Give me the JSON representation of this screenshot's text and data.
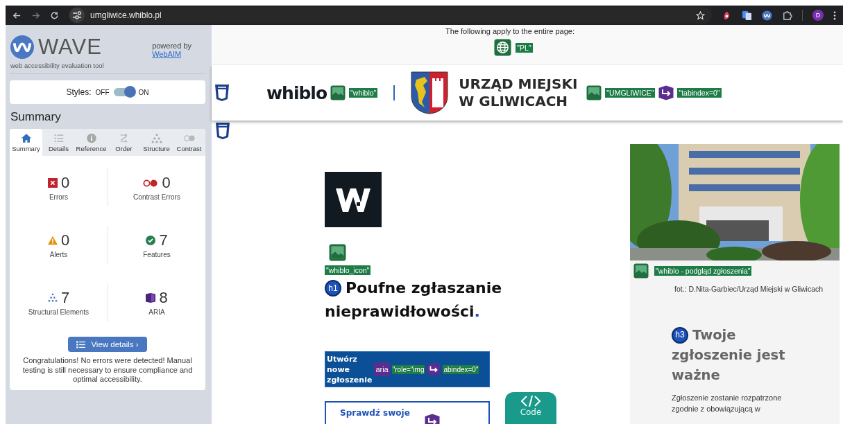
{
  "browser": {
    "url": "umgliwice.whiblo.pl",
    "profile_initial": "D"
  },
  "wave": {
    "title": "WAVE",
    "tagline": "web accessibility evaluation tool",
    "powered_by": "powered by",
    "powered_link": "WebAIM",
    "styles": {
      "label": "Styles:",
      "off_label": "OFF",
      "on_label": "ON",
      "on": true
    },
    "heading": "Summary",
    "tabs": [
      {
        "label": "Summary",
        "kind": "home",
        "selected": true
      },
      {
        "label": "Details",
        "kind": "list",
        "selected": false
      },
      {
        "label": "Reference",
        "kind": "info",
        "selected": false
      },
      {
        "label": "Order",
        "kind": "order",
        "selected": false
      },
      {
        "label": "Structure",
        "kind": "tree",
        "selected": false
      },
      {
        "label": "Contrast",
        "kind": "contrast",
        "selected": false
      }
    ],
    "stats": [
      {
        "kind": "error",
        "count": "0",
        "label": "Errors"
      },
      {
        "kind": "contrast",
        "count": "0",
        "label": "Contrast Errors"
      },
      {
        "kind": "alert",
        "count": "0",
        "label": "Alerts"
      },
      {
        "kind": "feature",
        "count": "7",
        "label": "Features"
      },
      {
        "kind": "structure",
        "count": "7",
        "label": "Structural Elements"
      },
      {
        "kind": "aria",
        "count": "8",
        "label": "ARIA"
      }
    ],
    "view_details": "View details ›",
    "message": "Congratulations! No errors were detected! Manual testing is still necessary to ensure compliance and optimal accessibility."
  },
  "page": {
    "global_notice": "The following apply to the entire page:",
    "global_label": "\"PL\"",
    "header": {
      "brand": "whiblo",
      "brand_alt": "\"whiblo\"",
      "city_line1": "URZĄD MIEJSKI",
      "city_line2": "W GLIWICACH",
      "city_alt": "\"UMGLIWICE\"",
      "tabindex": "\"tabindex=0\""
    },
    "logo_alt": "\"whiblo_icon\"",
    "h1_tag": "h1",
    "h1_lines": [
      "Poufne zgłaszanie",
      "nieprawidłowości"
    ],
    "h1_end": ".",
    "buttons": [
      {
        "kind": "filled",
        "lines": [
          "Utwórz",
          "nowe",
          "zgłoszenie"
        ],
        "aria": "aria",
        "role": "\"role=\"img",
        "tabindex": "abindex=0\""
      },
      {
        "kind": "outline",
        "lines": [
          "Sprawdź swoje"
        ]
      }
    ],
    "code_button": "Code",
    "photo_alt": "\"whiblo - podgląd zgłoszenia\"",
    "credit": "fot.: D.Nita-Garbiec/Urząd Miejski w Gliwicach",
    "h3_tag": "h3",
    "h3_lines": [
      "Twoje",
      "zgłoszenie jest",
      "ważne"
    ],
    "body": [
      "Zgłoszenie zostanie rozpatrzone",
      "zgodnie z obowiązującą w"
    ]
  }
}
